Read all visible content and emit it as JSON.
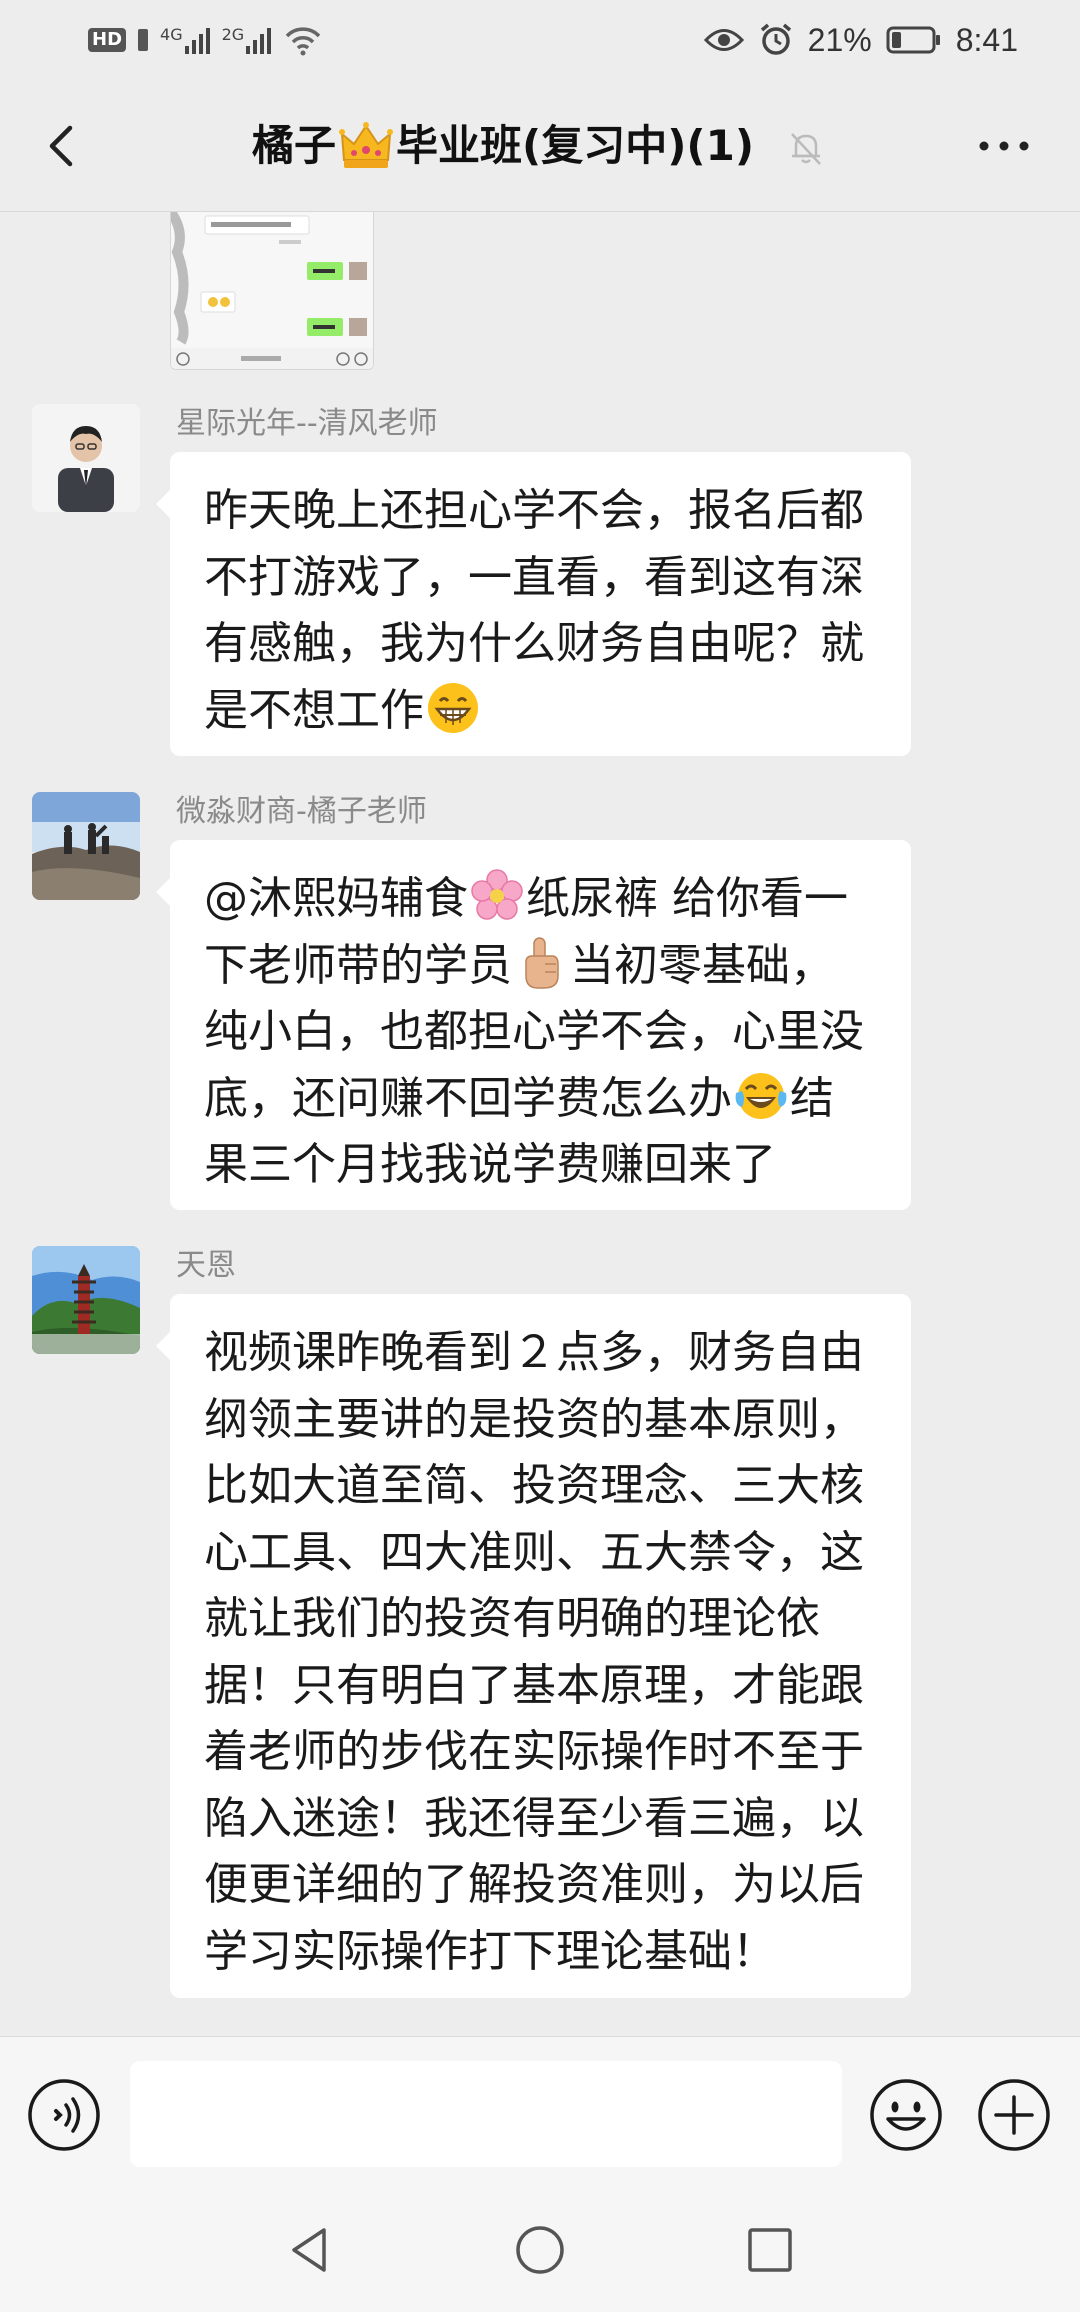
{
  "status_bar": {
    "left": {
      "hd": "HD",
      "sim1_network": "4G",
      "sim2_network": "2G"
    },
    "battery_percent": "21%",
    "time": "8:41"
  },
  "header": {
    "title_prefix": "橘子",
    "title_suffix": "毕业班(复习中)(1)",
    "icons": {
      "back": "chevron-left-icon",
      "crown": "crown-emoji",
      "mute": "bell-off-icon",
      "more": "more-dots-icon"
    }
  },
  "messages": [
    {
      "sender": "星际光年--清风老师",
      "lines": [
        "昨天晚上还担心学不会，报名后都",
        "不打游戏了，一直看，看到这有深",
        "有感触，我为什么财务自由呢？就",
        "是不想工作"
      ],
      "trailing_emoji": "grinning-face-emoji"
    },
    {
      "sender": "微淼财商-橘子老师",
      "line1_a": "@沐熙妈辅食",
      "line1_b": "纸尿裤  给你看一",
      "line2_a": "下老师带的学员",
      "line2_b": "当初零基础，",
      "line3": "纯小白，也都担心学不会，心里没",
      "line4_a": "底，还问赚不回学费怎么办",
      "line4_b": "结",
      "line5": "果三个月找我说学费赚回来了",
      "emojis": [
        "cherry-blossom-emoji",
        "pointing-up-emoji",
        "tears-of-joy-emoji"
      ]
    },
    {
      "sender": "天恩",
      "lines": [
        "视频课昨晚看到２点多，财务自由",
        "纲领主要讲的是投资的基本原则，",
        "比如大道至简、投资理念、三大核",
        "心工具、四大准则、五大禁令，这",
        "就让我们的投资有明确的理论依",
        "据！只有明白了基本原理，才能跟",
        "着老师的步伐在实际操作时不至于",
        "陷入迷途！我还得至少看三遍，以",
        "便更详细的了解投资准则，为以后",
        "学习实际操作打下理论基础！"
      ]
    }
  ],
  "input_bar": {
    "value": "",
    "icons": {
      "voice": "voice-icon",
      "emoji": "emoji-icon",
      "plus": "plus-icon"
    }
  },
  "nav_bar": {
    "icons": [
      "nav-back-icon",
      "nav-home-icon",
      "nav-recent-icon"
    ]
  },
  "colors": {
    "background": "#ededed",
    "bubble": "#ffffff",
    "sender_name": "#8a8a8a",
    "accent_green": "#95ec69"
  }
}
